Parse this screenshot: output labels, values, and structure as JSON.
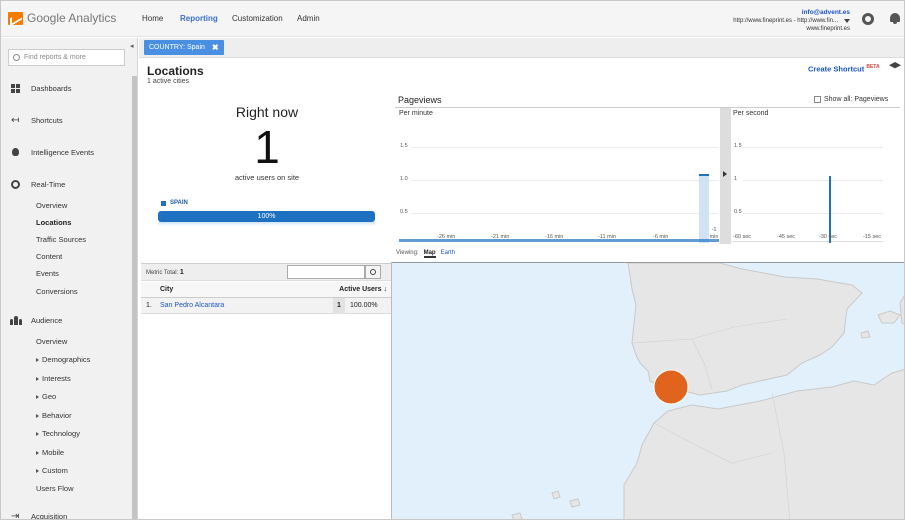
{
  "brand": {
    "name": "Google Analytics"
  },
  "nav": [
    "Home",
    "Reporting",
    "Customization",
    "Admin"
  ],
  "account": {
    "email": "info@advent.es",
    "url": "http://www.fineprint.es - http://www.fin...",
    "site": "www.fineprint.es"
  },
  "sidebar": {
    "search_placeholder": "Find reports & more",
    "sections": [
      {
        "label": "Dashboards",
        "icon": "dashboard-icon"
      },
      {
        "label": "Shortcuts",
        "icon": "shortcut-icon"
      },
      {
        "label": "Intelligence Events",
        "icon": "lightbulb-icon"
      },
      {
        "label": "Real-Time",
        "icon": "clock-icon"
      },
      {
        "label": "Audience",
        "icon": "people-icon"
      },
      {
        "label": "Acquisition",
        "icon": "acquisition-icon"
      }
    ],
    "realtime_items": [
      "Overview",
      "Locations",
      "Traffic Sources",
      "Content",
      "Events",
      "Conversions"
    ],
    "audience_items": [
      "Overview",
      "Demographics",
      "Interests",
      "Geo",
      "Behavior",
      "Technology",
      "Mobile",
      "Custom",
      "Users Flow"
    ]
  },
  "filter": {
    "chip": "COUNTRY: Spain",
    "close": "✖"
  },
  "page": {
    "title": "Locations",
    "subtitle": "1 active cities",
    "shortcut": "Create Shortcut",
    "beta": "BETA"
  },
  "rightnow": {
    "title": "Right now",
    "count": "1",
    "label": "active users on site",
    "legend": "SPAIN",
    "bar_label": "100%",
    "bar_fraction": 1.0
  },
  "pageviews": {
    "title": "Pageviews",
    "show_all": "Show all: Pageviews",
    "per_minute": "Per minute",
    "per_second": "Per second",
    "min_yticks": [
      "1.5",
      "1.0",
      "0.5"
    ],
    "sec_yticks": [
      "1.5",
      "1",
      "0.5"
    ],
    "min_xticks": [
      "-26 min",
      "-21 min",
      "-16 min",
      "-11 min",
      "-6 min",
      "-1 min"
    ],
    "sec_xticks": [
      "-60 sec",
      "-45 sec",
      "-30 sec",
      "-15 sec"
    ]
  },
  "viewing": {
    "label": "Viewing:",
    "map": "Map",
    "earth": "Earth"
  },
  "table": {
    "metric_label": "Metric Total:",
    "metric_total": "1",
    "col_city": "City",
    "col_users": "Active Users ↓",
    "rows": [
      {
        "n": "1.",
        "city": "San Pedro Alcantara",
        "users": "1",
        "pct": "100.00%"
      }
    ]
  },
  "colors": {
    "accent": "#1e70c1",
    "marker": "#e0641e",
    "land": "#e6e6e6",
    "water": "#e1f0fb"
  }
}
